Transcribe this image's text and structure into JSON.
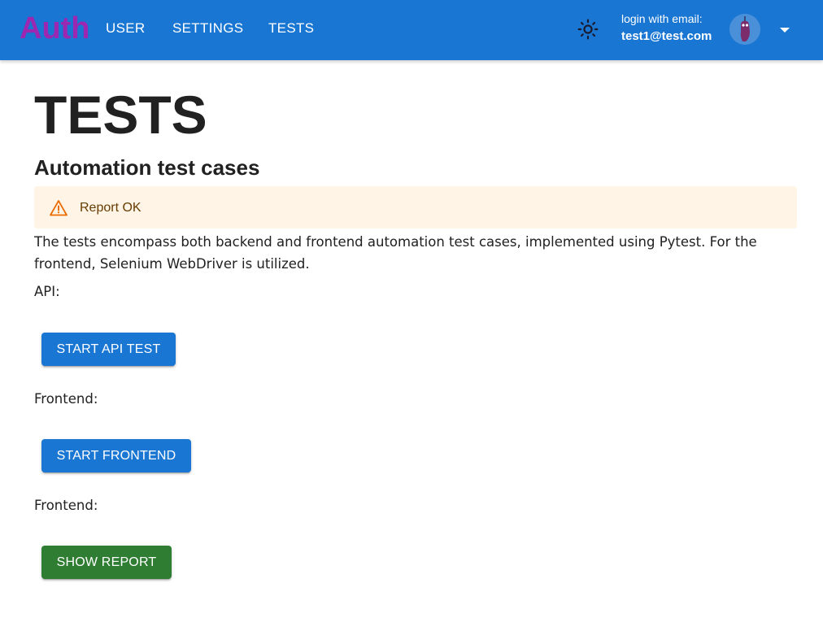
{
  "appbar": {
    "logo": "Auth",
    "nav": [
      "USER",
      "SETTINGS",
      "TESTS"
    ],
    "theme_icon": "sun-icon",
    "login_label": "login with email:",
    "login_email": "test1@test.com",
    "menu_icon": "caret-down-icon"
  },
  "main": {
    "title": "TESTS",
    "subtitle": "Automation test cases",
    "alert": {
      "icon": "warning-icon",
      "text": "Report OK"
    },
    "description": "The tests encompass both backend and frontend automation test cases, implemented using Pytest. For the frontend, Selenium WebDriver is utilized.",
    "sections": [
      {
        "label": "API:",
        "button": "START API TEST"
      },
      {
        "label": "Frontend:",
        "button": "START FRONTEND"
      },
      {
        "label": "Frontend:",
        "button": "SHOW REPORT"
      }
    ]
  },
  "colors": {
    "appbar": "#1976d2",
    "logo": "#9c27b0",
    "primary_button": "#1976d2",
    "success_button": "#2e7d32",
    "alert_background": "#fff4e5",
    "alert_icon": "#ed6c02"
  }
}
